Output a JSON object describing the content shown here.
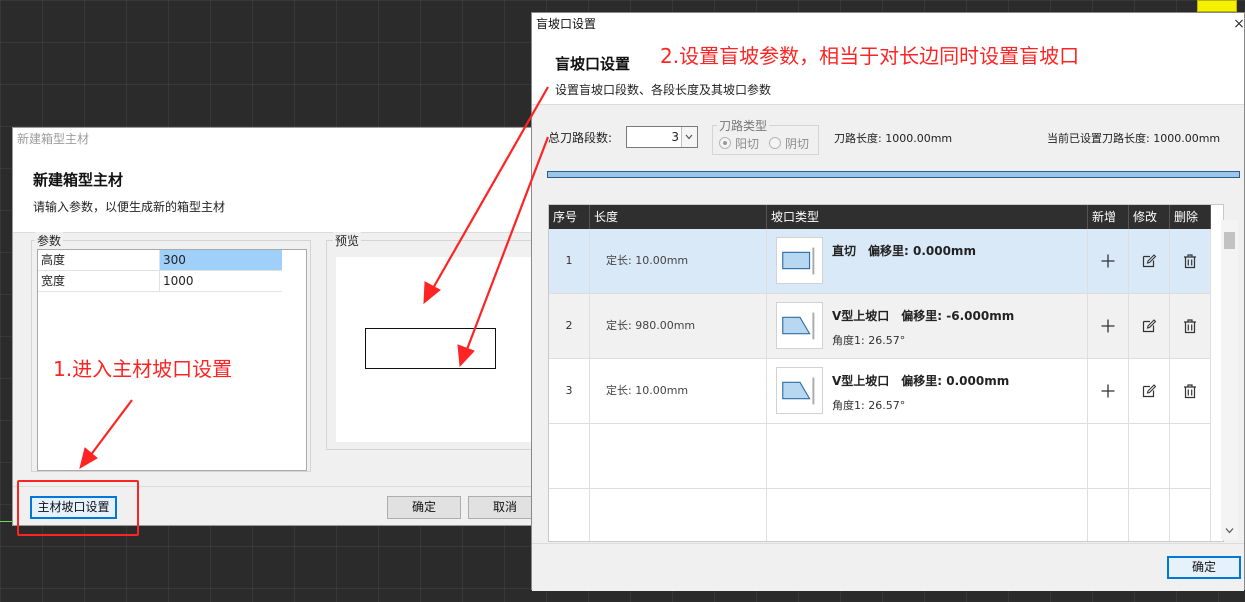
{
  "left_dialog": {
    "window_title": "新建箱型主材",
    "heading": "新建箱型主材",
    "subheading": "请输入参数，以便生成新的箱型主材",
    "params_label": "参数",
    "params": [
      {
        "name": "高度",
        "value": "300",
        "selected": true
      },
      {
        "name": "宽度",
        "value": "1000",
        "selected": false
      }
    ],
    "preview_label": "预览",
    "bevel_button": "主材坡口设置",
    "ok_button": "确定",
    "cancel_button": "取消"
  },
  "right_dialog": {
    "window_title": "盲坡口设置",
    "close_icon": "×",
    "heading": "盲坡口设置",
    "subheading": "设置盲坡口段数、各段长度及其坡口参数",
    "segments_label": "总刀路段数:",
    "segments_value": "3",
    "path_type_label": "刀路类型",
    "path_type_options": [
      "阳切",
      "阴切"
    ],
    "path_type_selected": "阳切",
    "path_length_text": "刀路长度: 1000.00mm",
    "current_length_text": "当前已设置刀路长度: 1000.00mm",
    "progress_percent": 100,
    "table": {
      "headers": [
        "序号",
        "长度",
        "坡口类型",
        "新增",
        "修改",
        "删除"
      ],
      "rows": [
        {
          "seq": "1",
          "length": "定长: 10.00mm",
          "type": "直切　偏移里: 0.000mm",
          "angle": "",
          "shape": "straight",
          "selected": true
        },
        {
          "seq": "2",
          "length": "定长: 980.00mm",
          "type": "V型上坡口　偏移里: -6.000mm",
          "angle": "角度1: 26.57°",
          "shape": "v-bevel",
          "selected": false
        },
        {
          "seq": "3",
          "length": "定长: 10.00mm",
          "type": "V型上坡口　偏移里: 0.000mm",
          "angle": "角度1: 26.57°",
          "shape": "v-bevel",
          "selected": false
        }
      ]
    },
    "ok_button": "确定"
  },
  "annotations": {
    "step1": "1.进入主材坡口设置",
    "step2": "2.设置盲坡参数，相当于对长边同时设置盲坡口"
  },
  "icons": {
    "add": "plus-icon",
    "edit": "edit-icon",
    "delete": "trash-icon",
    "spin": "chevron-down-icon"
  },
  "colors": {
    "annotation_red": "#ff2424",
    "selection_blue": "#9fd0fa",
    "focus_border": "#0078d7",
    "table_header": "#2f2f2f"
  }
}
